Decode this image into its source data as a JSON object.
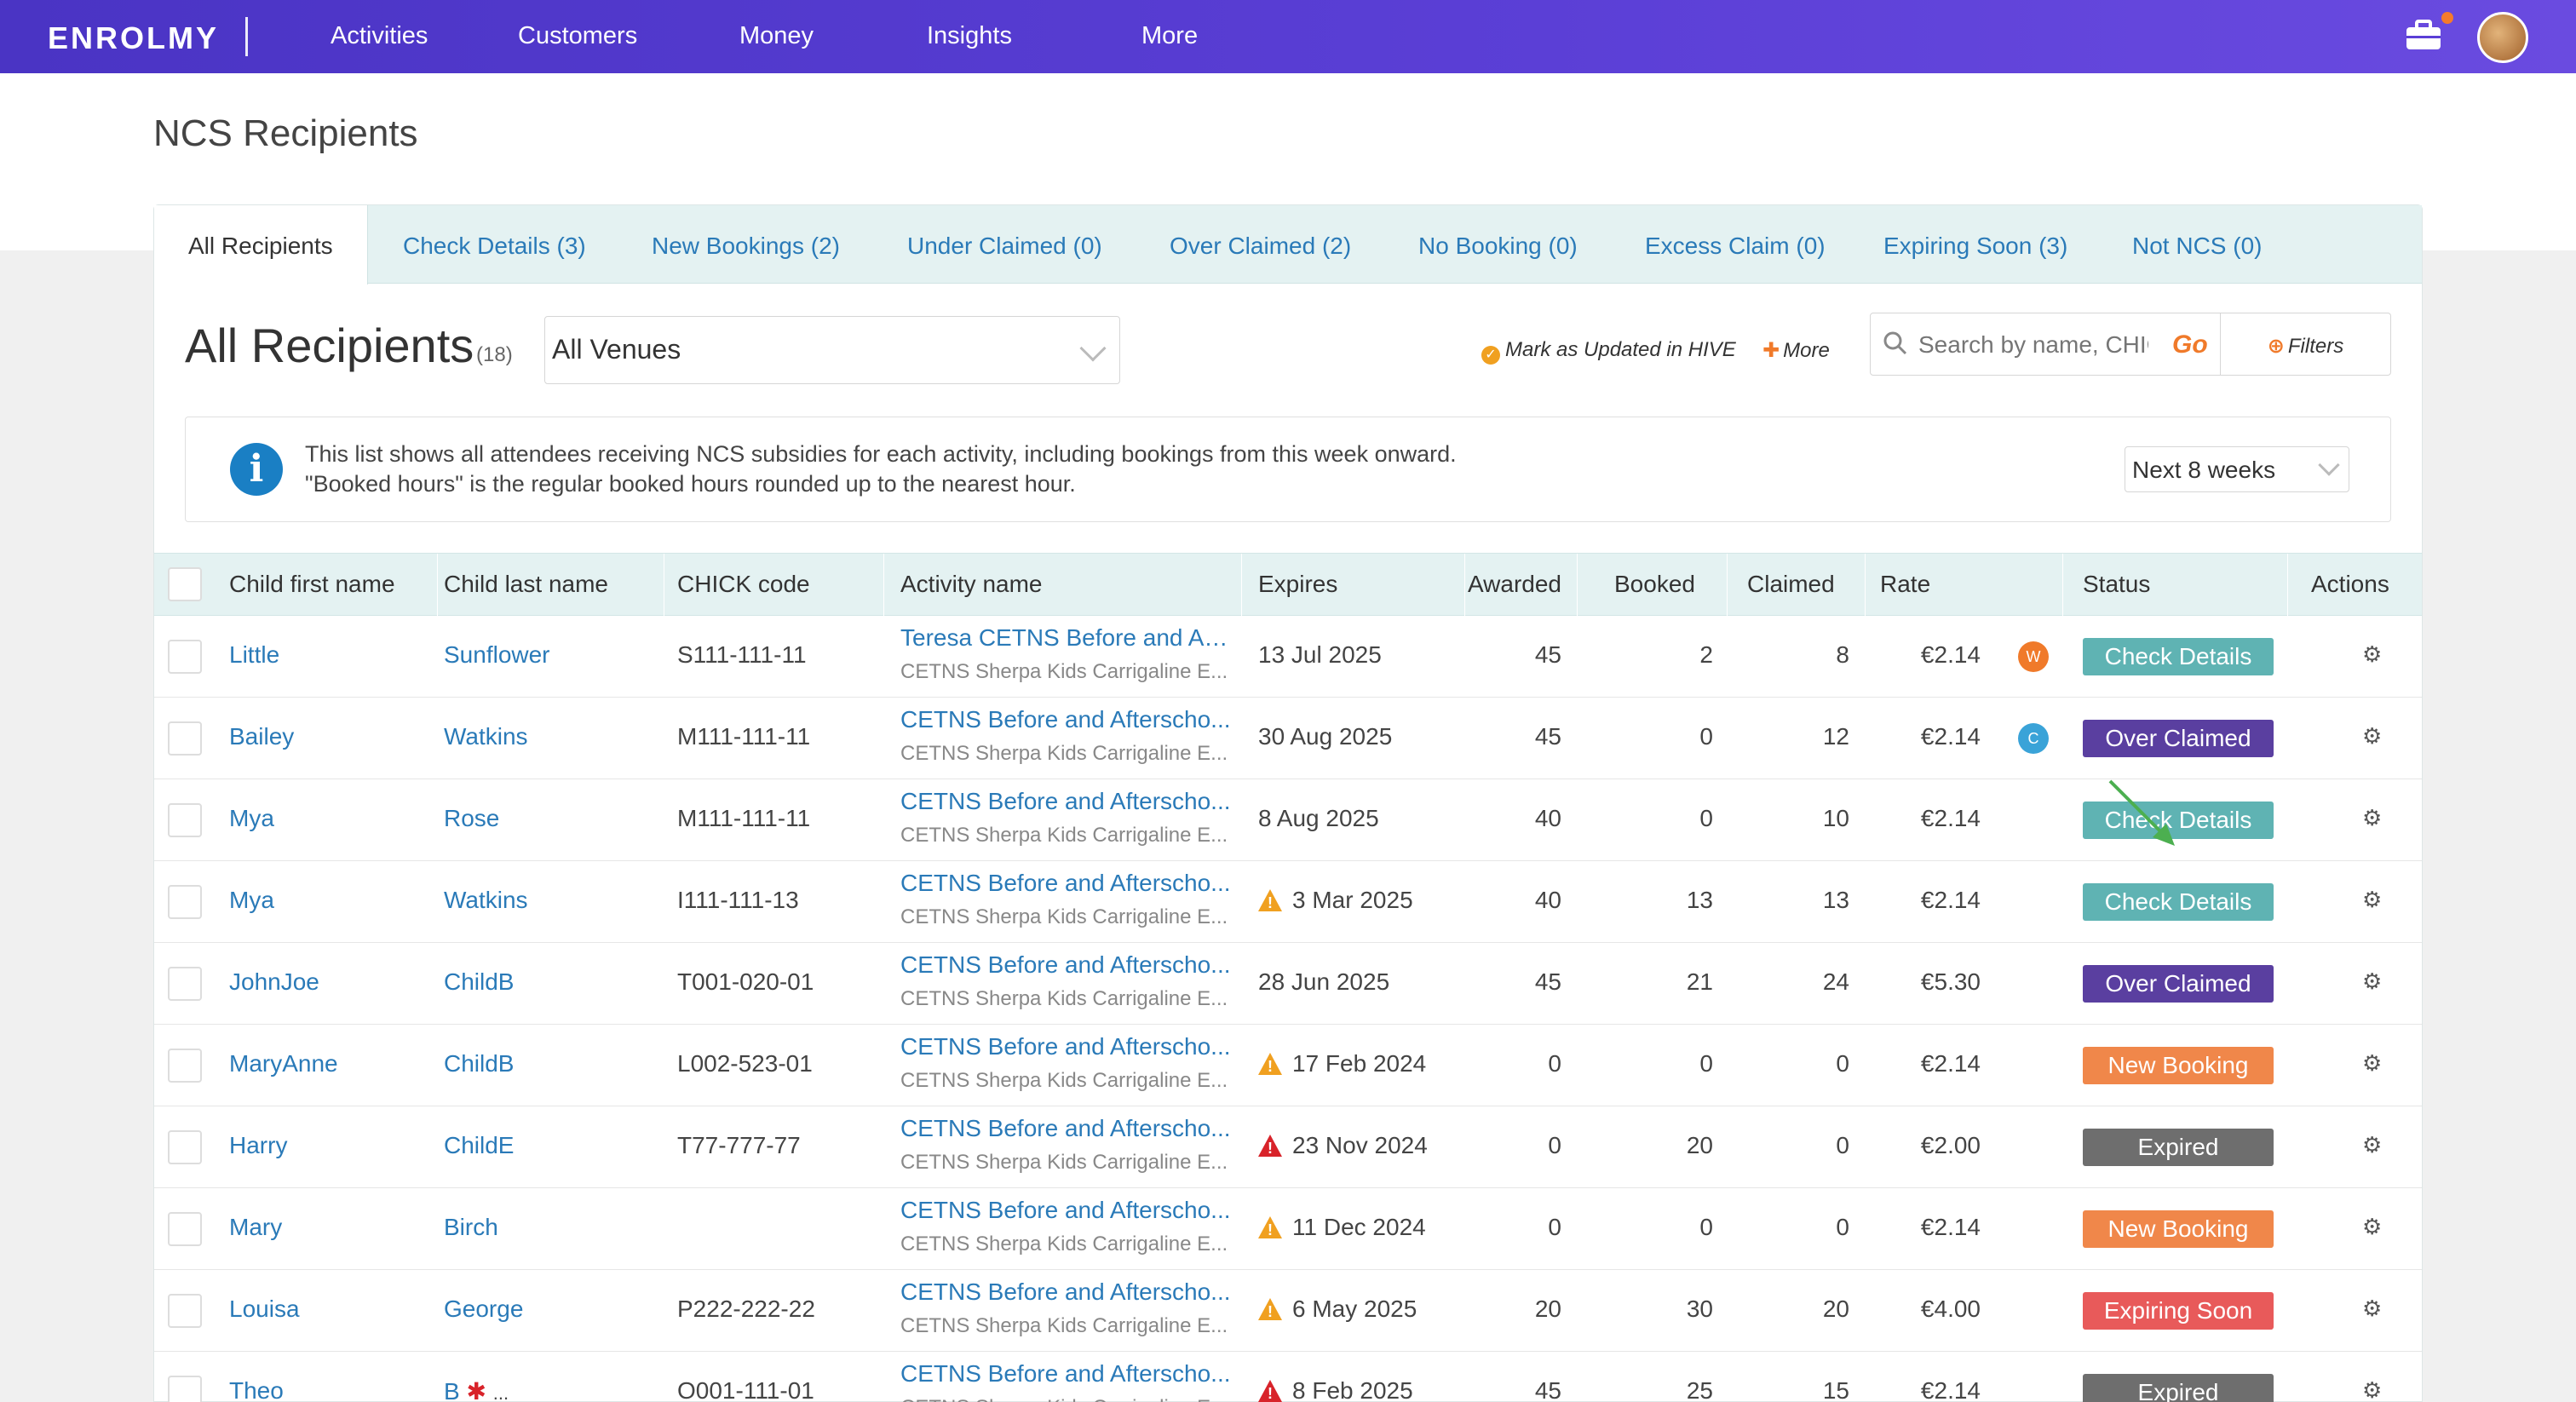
{
  "nav": {
    "logo": "ENROLMY",
    "items": [
      "Activities",
      "Customers",
      "Money",
      "Insights",
      "More"
    ]
  },
  "page": {
    "title": "NCS Recipients"
  },
  "tabs": [
    {
      "label": "All Recipients",
      "active": true
    },
    {
      "label": "Check Details (3)"
    },
    {
      "label": "New Bookings (2)"
    },
    {
      "label": "Under Claimed (0)"
    },
    {
      "label": "Over Claimed (2)"
    },
    {
      "label": "No Booking (0)"
    },
    {
      "label": "Excess Claim (0)"
    },
    {
      "label": "Expiring Soon (3)"
    },
    {
      "label": "Not NCS (0)"
    }
  ],
  "section": {
    "title": "All Recipients",
    "count": "(18)"
  },
  "venue": {
    "selected": "All Venues"
  },
  "toolbar": {
    "mark_updated": "Mark as Updated in HIVE",
    "more": "More",
    "search_placeholder": "Search by name, CHICK",
    "go": "Go",
    "filters": "Filters"
  },
  "info": {
    "line1": "This list shows all attendees receiving NCS subsidies for each activity, including bookings from this week onward.",
    "line2": "\"Booked hours\" is the regular booked hours rounded up to the nearest hour.",
    "weeks": "Next 8 weeks"
  },
  "columns": [
    "Child first name",
    "Child last name",
    "CHICK code",
    "Activity name",
    "Expires",
    "Awarded",
    "Booked",
    "Claimed",
    "Rate",
    "Status",
    "Actions"
  ],
  "rows": [
    {
      "first": "Little",
      "last": "Sunflower",
      "chick": "S111-111-11",
      "activity": "Teresa CETNS Before and Aft...",
      "venue": "CETNS Sherpa Kids Carrigaline E...",
      "expires": "13 Jul 2025",
      "warn": "",
      "awarded": "45",
      "booked": "2",
      "claimed": "8",
      "rate": "€2.14",
      "marker": "W",
      "status": "Check Details"
    },
    {
      "first": "Bailey",
      "last": "Watkins",
      "chick": "M111-111-11",
      "activity": "CETNS Before and Afterscho...",
      "venue": "CETNS Sherpa Kids Carrigaline E...",
      "expires": "30 Aug 2025",
      "warn": "",
      "awarded": "45",
      "booked": "0",
      "claimed": "12",
      "rate": "€2.14",
      "marker": "C",
      "status": "Over Claimed"
    },
    {
      "first": "Mya",
      "last": "Rose",
      "chick": "M111-111-11",
      "activity": "CETNS Before and Afterscho...",
      "venue": "CETNS Sherpa Kids Carrigaline E...",
      "expires": "8 Aug 2025",
      "warn": "",
      "awarded": "40",
      "booked": "0",
      "claimed": "10",
      "rate": "€2.14",
      "marker": "",
      "status": "Check Details"
    },
    {
      "first": "Mya",
      "last": "Watkins",
      "chick": "I111-111-13",
      "activity": "CETNS Before and Afterscho...",
      "venue": "CETNS Sherpa Kids Carrigaline E...",
      "expires": "3 Mar 2025",
      "warn": "orange",
      "awarded": "40",
      "booked": "13",
      "claimed": "13",
      "rate": "€2.14",
      "marker": "",
      "status": "Check Details"
    },
    {
      "first": "JohnJoe",
      "last": "ChildB",
      "chick": "T001-020-01",
      "activity": "CETNS Before and Afterscho...",
      "venue": "CETNS Sherpa Kids Carrigaline E...",
      "expires": "28 Jun 2025",
      "warn": "",
      "awarded": "45",
      "booked": "21",
      "claimed": "24",
      "rate": "€5.30",
      "marker": "",
      "status": "Over Claimed"
    },
    {
      "first": "MaryAnne",
      "last": "ChildB",
      "chick": "L002-523-01",
      "activity": "CETNS Before and Afterscho...",
      "venue": "CETNS Sherpa Kids Carrigaline E...",
      "expires": "17 Feb 2024",
      "warn": "orange",
      "awarded": "0",
      "booked": "0",
      "claimed": "0",
      "rate": "€2.14",
      "marker": "",
      "status": "New Booking"
    },
    {
      "first": "Harry",
      "last": "ChildE",
      "chick": "T77-777-77",
      "activity": "CETNS Before and Afterscho...",
      "venue": "CETNS Sherpa Kids Carrigaline E...",
      "expires": "23 Nov 2024",
      "warn": "red",
      "awarded": "0",
      "booked": "20",
      "claimed": "0",
      "rate": "€2.00",
      "marker": "",
      "status": "Expired"
    },
    {
      "first": "Mary",
      "last": "Birch",
      "chick": "",
      "activity": "CETNS Before and Afterscho...",
      "venue": "CETNS Sherpa Kids Carrigaline E...",
      "expires": "11 Dec 2024",
      "warn": "orange",
      "awarded": "0",
      "booked": "0",
      "claimed": "0",
      "rate": "€2.14",
      "marker": "",
      "status": "New Booking"
    },
    {
      "first": "Louisa",
      "last": "George",
      "chick": "P222-222-22",
      "activity": "CETNS Before and Afterscho...",
      "venue": "CETNS Sherpa Kids Carrigaline E...",
      "expires": "6 May 2025",
      "warn": "orange",
      "awarded": "20",
      "booked": "30",
      "claimed": "20",
      "rate": "€4.00",
      "marker": "",
      "status": "Expiring Soon"
    },
    {
      "first": "Theo",
      "last": "B",
      "last_flag": "✱",
      "last_more": "...",
      "chick": "O001-111-01",
      "activity": "CETNS Before and Afterscho...",
      "venue": "CETNS Sherpa Kids Carrigaline E...",
      "expires": "8 Feb 2025",
      "warn": "red",
      "awarded": "45",
      "booked": "25",
      "claimed": "15",
      "rate": "€2.14",
      "marker": "",
      "status": "Expired"
    }
  ],
  "status_colors": {
    "Check Details": "#5fb3b3",
    "Over Claimed": "#5a3fa0",
    "New Booking": "#f0874a",
    "Expired": "#6e6e6e",
    "Expiring Soon": "#e85a5a"
  },
  "marker_colors": {
    "W": "#f07a2a",
    "C": "#3aa3d8"
  },
  "icons": {
    "actions": "gear-icon",
    "search": "search-icon",
    "info": "info-icon",
    "warning": "warning-icon"
  }
}
